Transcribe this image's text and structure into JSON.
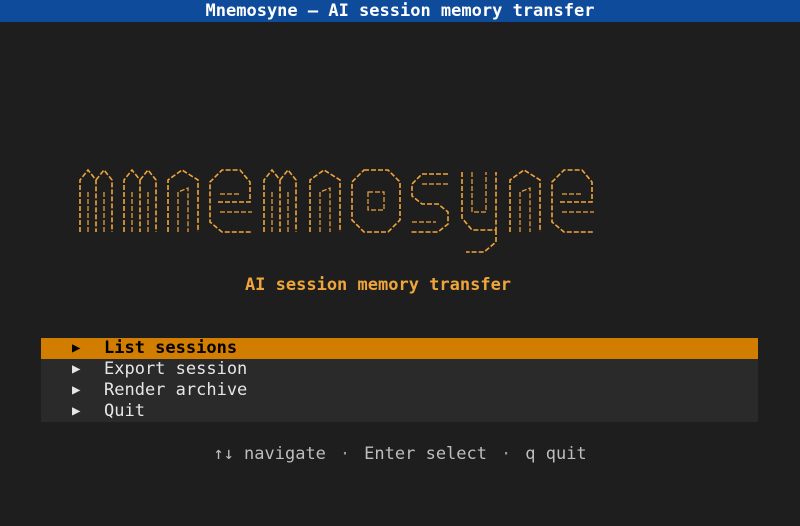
{
  "window": {
    "title": "Mnemosyne — AI session memory transfer"
  },
  "logo": {
    "wordmark": "mnemosyne",
    "color": "#f0a53a"
  },
  "subtitle": "AI session memory transfer",
  "menu": {
    "selected_index": 0,
    "items": [
      {
        "arrow": "▶",
        "label": "List sessions"
      },
      {
        "arrow": "▶",
        "label": "Export session"
      },
      {
        "arrow": "▶",
        "label": "Render archive"
      },
      {
        "arrow": "▶",
        "label": "Quit"
      }
    ]
  },
  "hints": {
    "navigate": "↑↓ navigate",
    "select": "Enter select",
    "quit": "q quit",
    "separator": "·"
  },
  "colors": {
    "titlebar": "#0e4c9b",
    "background": "#1e1e1e",
    "accent": "#f0a53a",
    "selection": "#d17d00"
  }
}
